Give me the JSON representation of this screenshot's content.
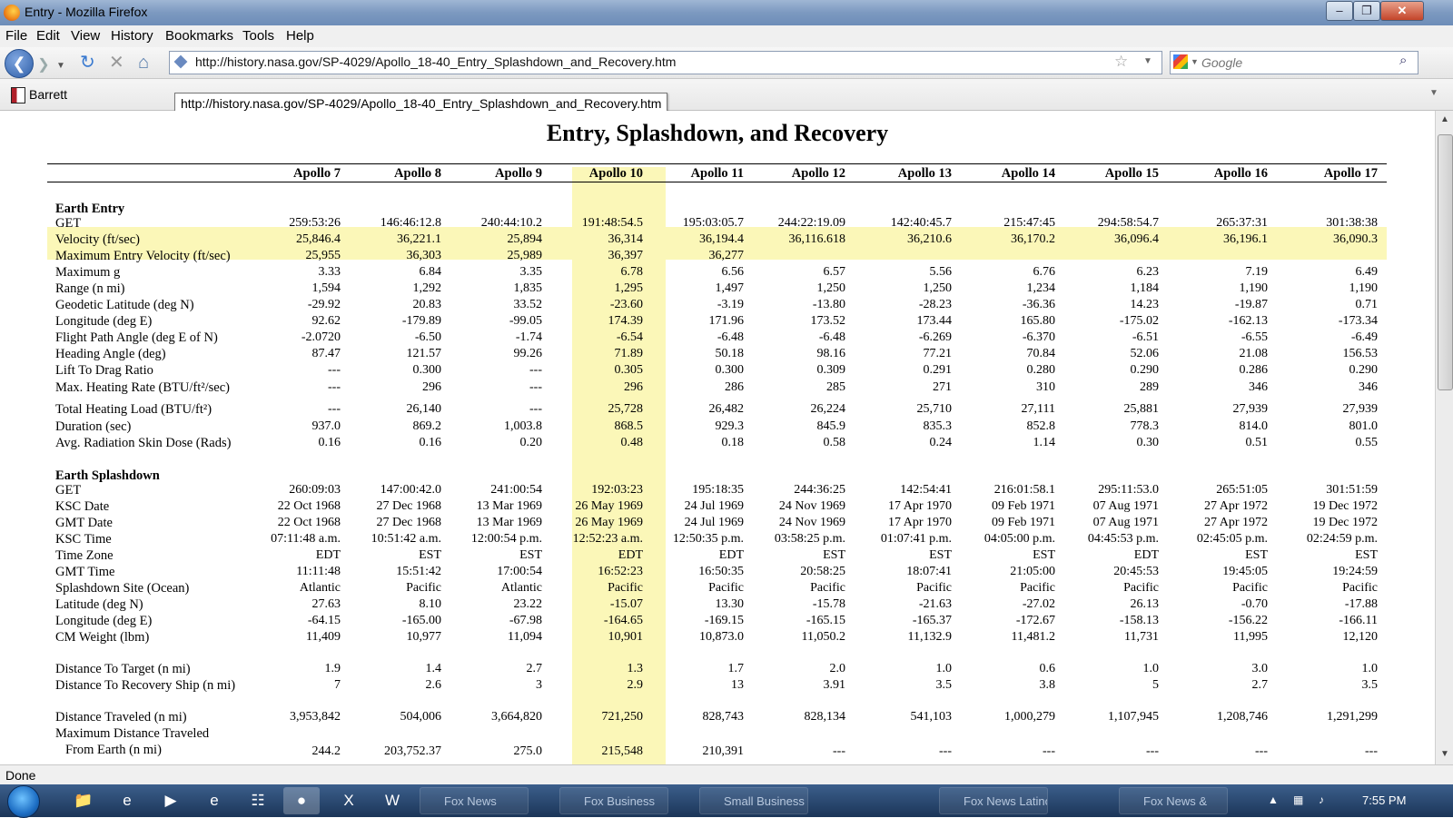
{
  "window": {
    "title": "Entry - Mozilla Firefox"
  },
  "menu": [
    "File",
    "Edit",
    "View",
    "History",
    "Bookmarks",
    "Tools",
    "Help"
  ],
  "nav": {
    "url": "http://history.nasa.gov/SP-4029/Apollo_18-40_Entry_Splashdown_and_Recovery.htm",
    "search_placeholder": "Google"
  },
  "bookmarks": {
    "item": "Barrett"
  },
  "tooltip": "http://history.nasa.gov/SP-4029/Apollo_18-40_Entry_Splashdown_and_Recovery.htm",
  "page": {
    "title": "Entry, Splashdown, and Recovery",
    "columns": [
      "Apollo 7",
      "Apollo 8",
      "Apollo 9",
      "Apollo 10",
      "Apollo 11",
      "Apollo 12",
      "Apollo 13",
      "Apollo 14",
      "Apollo 15",
      "Apollo 16",
      "Apollo 17"
    ],
    "sections": {
      "entry": "Earth Entry",
      "splashdown": "Earth Splashdown"
    },
    "rows": [
      {
        "label": "GET",
        "values": [
          "259:53:26",
          "146:46:12.8",
          "240:44:10.2",
          "191:48:54.5",
          "195:03:05.7",
          "244:22:19.09",
          "142:40:45.7",
          "215:47:45",
          "294:58:54.7",
          "265:37:31",
          "301:38:38"
        ]
      },
      {
        "label": "Velocity (ft/sec)",
        "values": [
          "25,846.4",
          "36,221.1",
          "25,894",
          "36,314",
          "36,194.4",
          "36,116.618",
          "36,210.6",
          "36,170.2",
          "36,096.4",
          "36,196.1",
          "36,090.3"
        ]
      },
      {
        "label": "Maximum Entry Velocity (ft/sec)",
        "values": [
          "25,955",
          "36,303",
          "25,989",
          "36,397",
          "36,277",
          "",
          "",
          "",
          "",
          "",
          ""
        ]
      },
      {
        "label": "Maximum g",
        "values": [
          "3.33",
          "6.84",
          "3.35",
          "6.78",
          "6.56",
          "6.57",
          "5.56",
          "6.76",
          "6.23",
          "7.19",
          "6.49"
        ]
      },
      {
        "label": "Range (n mi)",
        "values": [
          "1,594",
          "1,292",
          "1,835",
          "1,295",
          "1,497",
          "1,250",
          "1,250",
          "1,234",
          "1,184",
          "1,190",
          "1,190"
        ]
      },
      {
        "label": "Geodetic Latitude (deg N)",
        "values": [
          "-29.92",
          "20.83",
          "33.52",
          "-23.60",
          "-3.19",
          "-13.80",
          "-28.23",
          "-36.36",
          "14.23",
          "-19.87",
          "0.71"
        ]
      },
      {
        "label": "Longitude (deg E)",
        "values": [
          "92.62",
          "-179.89",
          "-99.05",
          "174.39",
          "171.96",
          "173.52",
          "173.44",
          "165.80",
          "-175.02",
          "-162.13",
          "-173.34"
        ]
      },
      {
        "label": "Flight Path Angle (deg E of N)",
        "values": [
          "-2.0720",
          "-6.50",
          "-1.74",
          "-6.54",
          "-6.48",
          "-6.48",
          "-6.269",
          "-6.370",
          "-6.51",
          "-6.55",
          "-6.49"
        ]
      },
      {
        "label": "Heading Angle (deg)",
        "values": [
          "87.47",
          "121.57",
          "99.26",
          "71.89",
          "50.18",
          "98.16",
          "77.21",
          "70.84",
          "52.06",
          "21.08",
          "156.53"
        ]
      },
      {
        "label": "Lift To Drag Ratio",
        "values": [
          "---",
          "0.300",
          "---",
          "0.305",
          "0.300",
          "0.309",
          "0.291",
          "0.280",
          "0.290",
          "0.286",
          "0.290"
        ]
      },
      {
        "label": "Max. Heating Rate (BTU/ft²/sec)",
        "values": [
          "---",
          "296",
          "---",
          "296",
          "286",
          "285",
          "271",
          "310",
          "289",
          "346",
          "346"
        ]
      },
      {
        "label": "Total Heating Load (BTU/ft²)",
        "values": [
          "---",
          "26,140",
          "---",
          "25,728",
          "26,482",
          "26,224",
          "25,710",
          "27,111",
          "25,881",
          "27,939",
          "27,939"
        ]
      },
      {
        "label": "Duration (sec)",
        "values": [
          "937.0",
          "869.2",
          "1,003.8",
          "868.5",
          "929.3",
          "845.9",
          "835.3",
          "852.8",
          "778.3",
          "814.0",
          "801.0"
        ]
      },
      {
        "label": "Avg. Radiation Skin Dose (Rads)",
        "values": [
          "0.16",
          "0.16",
          "0.20",
          "0.48",
          "0.18",
          "0.58",
          "0.24",
          "1.14",
          "0.30",
          "0.51",
          "0.55"
        ]
      },
      {
        "label": "GET",
        "values": [
          "260:09:03",
          "147:00:42.0",
          "241:00:54",
          "192:03:23",
          "195:18:35",
          "244:36:25",
          "142:54:41",
          "216:01:58.1",
          "295:11:53.0",
          "265:51:05",
          "301:51:59"
        ]
      },
      {
        "label": "KSC Date",
        "values": [
          "22 Oct 1968",
          "27 Dec 1968",
          "13 Mar 1969",
          "26 May 1969",
          "24 Jul 1969",
          "24 Nov 1969",
          "17 Apr 1970",
          "09 Feb 1971",
          "07 Aug 1971",
          "27 Apr 1972",
          "19 Dec 1972"
        ]
      },
      {
        "label": "GMT Date",
        "values": [
          "22 Oct 1968",
          "27 Dec 1968",
          "13 Mar 1969",
          "26 May 1969",
          "24 Jul 1969",
          "24 Nov 1969",
          "17 Apr 1970",
          "09 Feb 1971",
          "07 Aug 1971",
          "27 Apr 1972",
          "19 Dec 1972"
        ]
      },
      {
        "label": "KSC Time",
        "values": [
          "07:11:48 a.m.",
          "10:51:42 a.m.",
          "12:00:54 p.m.",
          "12:52:23 a.m.",
          "12:50:35 p.m.",
          "03:58:25 p.m.",
          "01:07:41 p.m.",
          "04:05:00 p.m.",
          "04:45:53 p.m.",
          "02:45:05 p.m.",
          "02:24:59 p.m."
        ]
      },
      {
        "label": "Time Zone",
        "values": [
          "EDT",
          "EST",
          "EST",
          "EDT",
          "EDT",
          "EST",
          "EST",
          "EST",
          "EDT",
          "EST",
          "EST"
        ]
      },
      {
        "label": "GMT Time",
        "values": [
          "11:11:48",
          "15:51:42",
          "17:00:54",
          "16:52:23",
          "16:50:35",
          "20:58:25",
          "18:07:41",
          "21:05:00",
          "20:45:53",
          "19:45:05",
          "19:24:59"
        ]
      },
      {
        "label": "Splashdown Site (Ocean)",
        "values": [
          "Atlantic",
          "Pacific",
          "Atlantic",
          "Pacific",
          "Pacific",
          "Pacific",
          "Pacific",
          "Pacific",
          "Pacific",
          "Pacific",
          "Pacific"
        ]
      },
      {
        "label": "Latitude (deg N)",
        "values": [
          "27.63",
          "8.10",
          "23.22",
          "-15.07",
          "13.30",
          "-15.78",
          "-21.63",
          "-27.02",
          "26.13",
          "-0.70",
          "-17.88"
        ]
      },
      {
        "label": "Longitude (deg E)",
        "values": [
          "-64.15",
          "-165.00",
          "-67.98",
          "-164.65",
          "-169.15",
          "-165.15",
          "-165.37",
          "-172.67",
          "-158.13",
          "-156.22",
          "-166.11"
        ]
      },
      {
        "label": "CM Weight (lbm)",
        "values": [
          "11,409",
          "10,977",
          "11,094",
          "10,901",
          "10,873.0",
          "11,050.2",
          "11,132.9",
          "11,481.2",
          "11,731",
          "11,995",
          "12,120"
        ]
      },
      {
        "label": "Distance To Target (n mi)",
        "values": [
          "1.9",
          "1.4",
          "2.7",
          "1.3",
          "1.7",
          "2.0",
          "1.0",
          "0.6",
          "1.0",
          "3.0",
          "1.0"
        ]
      },
      {
        "label": "Distance To Recovery Ship (n mi)",
        "values": [
          "7",
          "2.6",
          "3",
          "2.9",
          "13",
          "3.91",
          "3.5",
          "3.8",
          "5",
          "2.7",
          "3.5"
        ]
      },
      {
        "label": "Distance Traveled (n mi)",
        "values": [
          "3,953,842",
          "504,006",
          "3,664,820",
          "721,250",
          "828,743",
          "828,134",
          "541,103",
          "1,000,279",
          "1,107,945",
          "1,208,746",
          "1,291,299"
        ]
      },
      {
        "label": "Maximum Distance Traveled",
        "values": [
          "",
          "",
          "",
          "",
          "",
          "",
          "",
          "",
          "",
          "",
          ""
        ]
      },
      {
        "label": "From Earth (n mi)",
        "values": [
          "244.2",
          "203,752.37",
          "275.0",
          "215,548",
          "210,391",
          "---",
          "---",
          "---",
          "---",
          "---",
          "---"
        ]
      }
    ]
  },
  "status": {
    "text": "Done"
  },
  "taskbar": {
    "tasks": [
      "Fox News",
      "Fox Business",
      "Small Business Center",
      "Fox News Latino",
      "Fox News &"
    ],
    "clock": "7:55 PM"
  },
  "colors": {
    "highlight": "#fbf7b8",
    "titlebar": "#7c99c0"
  },
  "icons": [
    "firefox-icon",
    "back-arrow-icon",
    "forward-arrow-icon",
    "reload-icon",
    "stop-icon",
    "home-icon",
    "site-identity-icon",
    "bookmark-star-icon",
    "google-icon",
    "search-icon",
    "start-orb-icon"
  ]
}
